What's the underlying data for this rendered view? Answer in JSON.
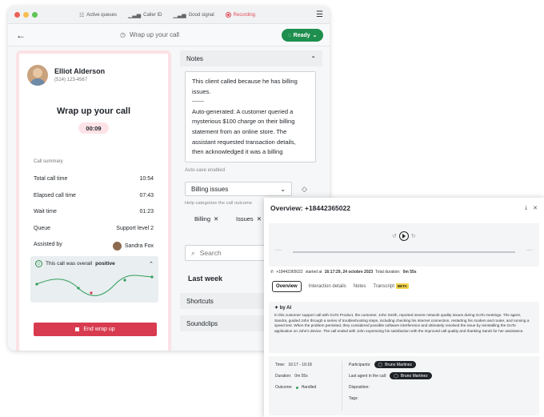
{
  "titlebar": {
    "active_queues": "Active queues",
    "caller_id": "Caller ID",
    "good_signal": "Good signal",
    "recording": "Recording"
  },
  "nav": {
    "title": "Wrap up your call",
    "ready": "Ready"
  },
  "contact": {
    "name": "Elliot Alderson",
    "phone": "(514) 123-4567"
  },
  "wrap": {
    "title": "Wrap up your call",
    "timer": "00:09"
  },
  "summary": {
    "label": "Call summary",
    "rows": [
      {
        "label": "Total call time",
        "value": "10:54"
      },
      {
        "label": "Elapsed call time",
        "value": "07:43"
      },
      {
        "label": "Wait time",
        "value": "01:23"
      },
      {
        "label": "Queue",
        "value": "Support level 2"
      },
      {
        "label": "Assisted by",
        "value": "Sandra Fox"
      }
    ]
  },
  "sentiment": {
    "prefix": "This call was overall",
    "value": "positive"
  },
  "end_button": "End wrap up",
  "notes": {
    "header": "Notes",
    "line1": "This client called because he has billing issues.",
    "line2": "------",
    "line3": "Auto-generated: A customer queried a mysterious $100 charge on their billing statement from an online store. The assistant requested transaction details, then acknowledged it was a billing",
    "autosave": "Auto-save enabled"
  },
  "disposition": {
    "selected": "Billing issues",
    "help": "Help categorize the call outcome",
    "chips": [
      "Billing",
      "Issues"
    ]
  },
  "search": {
    "placeholder": "Search"
  },
  "sections": {
    "last_week": "Last week",
    "shortcuts": "Shortcuts",
    "soundclips": "Soundclips"
  },
  "overview": {
    "title": "Overview: +18442365022",
    "player": {
      "start": "--:--",
      "end": "--:--"
    },
    "log_number": "+18442365022",
    "log_started": "started at",
    "log_date": "16:17:29, 24 octobre 2023",
    "log_total_label": "Total duration:",
    "log_total": "0m 55s",
    "tabs": [
      "Overview",
      "Interaction details",
      "Notes",
      "Transcript"
    ],
    "beta": "BETA",
    "ai_label": "by AI",
    "summary_text": "In this customer support call with GoTo Product, the customer, John Smith, reported severe network quality issues during GoTo meetings. The agent, Sandra, guided John through a series of troubleshooting steps, including checking his internet connection, restarting his modem and router, and running a speed test. When the problem persisted, they considered possible software interference and ultimately resolved the issue by reinstalling the GoTo application on John's device. The call ended with John expressing his satisfaction with the improved call quality and thanking Sarah for her assistance.",
    "time_label": "Time:",
    "time": "16:17 - 16:18",
    "duration_label": "Duration:",
    "duration": "0m 55s",
    "outcome_label": "Outcome:",
    "outcome": "Handled",
    "participants_label": "Participants:",
    "participant": "Bruno Martinez",
    "last_agent_label": "Last agent in the call:",
    "last_agent": "Bruno Martinez",
    "disposition_label": "Disposition:",
    "tags_label": "Tags:"
  },
  "colors": {
    "ready_green": "#1e8f4e",
    "end_red": "#d83b4f",
    "accent_pink": "#fbe2e6",
    "recording_red": "#e24a5a"
  }
}
